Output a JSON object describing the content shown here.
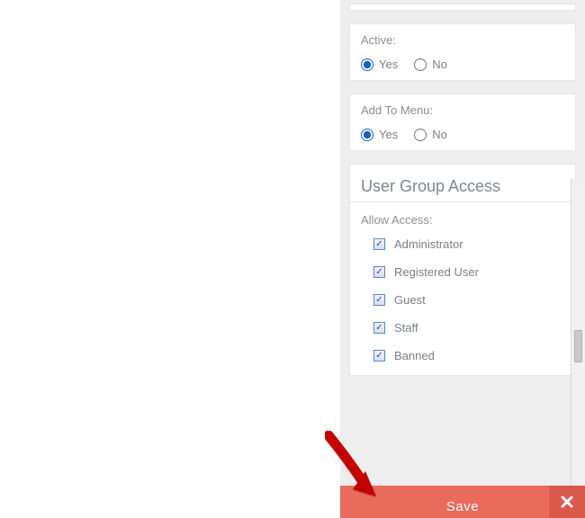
{
  "active": {
    "label": "Active:",
    "options": {
      "yes": "Yes",
      "no": "No"
    },
    "value": "yes"
  },
  "add_to_menu": {
    "label": "Add To Menu:",
    "options": {
      "yes": "Yes",
      "no": "No"
    },
    "value": "yes"
  },
  "user_group_access": {
    "title": "User Group Access",
    "allow_label": "Allow Access:",
    "groups": [
      {
        "label": "Administrator",
        "checked": true
      },
      {
        "label": "Registered User",
        "checked": true
      },
      {
        "label": "Guest",
        "checked": true
      },
      {
        "label": "Staff",
        "checked": true
      },
      {
        "label": "Banned",
        "checked": true
      }
    ]
  },
  "save_button": {
    "label": "Save"
  }
}
